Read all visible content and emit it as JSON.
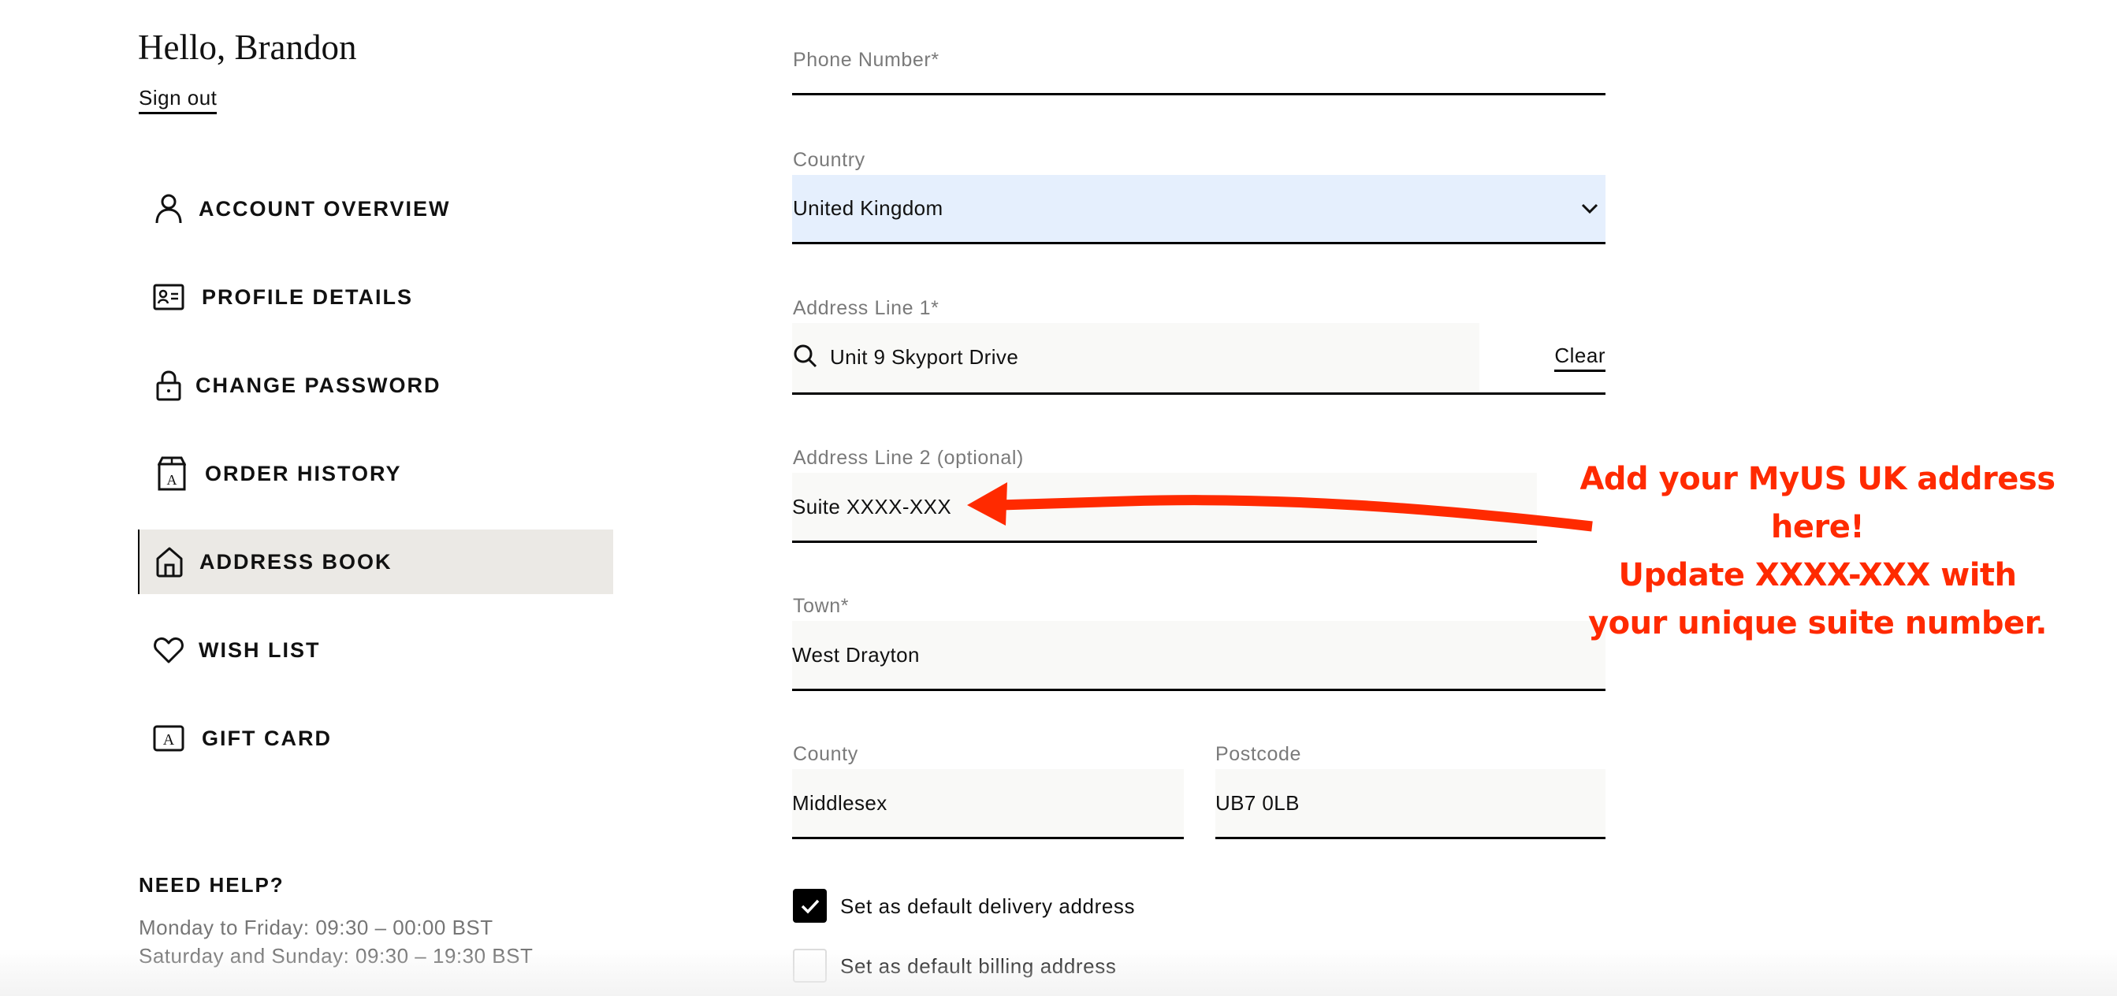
{
  "sidebar": {
    "greeting": "Hello, Brandon",
    "sign_out": "Sign out",
    "items": [
      {
        "label": "ACCOUNT OVERVIEW",
        "icon": "user-icon",
        "active": false
      },
      {
        "label": "PROFILE DETAILS",
        "icon": "id-card-icon",
        "active": false
      },
      {
        "label": "CHANGE PASSWORD",
        "icon": "lock-icon",
        "active": false
      },
      {
        "label": "ORDER HISTORY",
        "icon": "package-icon",
        "active": false
      },
      {
        "label": "ADDRESS BOOK",
        "icon": "home-icon",
        "active": true
      },
      {
        "label": "WISH LIST",
        "icon": "heart-icon",
        "active": false
      },
      {
        "label": "GIFT CARD",
        "icon": "gift-card-icon",
        "active": false
      }
    ],
    "help": {
      "title": "NEED HELP?",
      "weekday_hours": "Monday to Friday: 09:30 – 00:00 BST",
      "weekend_hours": "Saturday and Sunday: 09:30 – 19:30 BST"
    }
  },
  "form": {
    "phone": {
      "label": "Phone Number*",
      "value": ""
    },
    "country": {
      "label": "Country",
      "value": "United Kingdom"
    },
    "address1": {
      "label": "Address Line 1*",
      "value": "Unit 9 Skyport Drive",
      "clear_label": "Clear"
    },
    "address2": {
      "label": "Address Line 2 (optional)",
      "value": "Suite XXXX-XXX"
    },
    "town": {
      "label": "Town*",
      "value": "West Drayton"
    },
    "county": {
      "label": "County",
      "value": "Middlesex"
    },
    "postcode": {
      "label": "Postcode",
      "value": "UB7 0LB"
    },
    "default_delivery": {
      "label": "Set as default delivery address",
      "checked": true
    },
    "default_billing": {
      "label": "Set as default billing address",
      "checked": false
    }
  },
  "annotation": {
    "lines": [
      "Add your MyUS UK address here!",
      "Update XXXX-XXX with",
      "your unique suite number."
    ],
    "color": "#ff2a00"
  },
  "colors": {
    "active_nav_bg": "#ebe9e5",
    "country_select_bg": "#e5effd",
    "input_bg": "#f9f9f7"
  }
}
